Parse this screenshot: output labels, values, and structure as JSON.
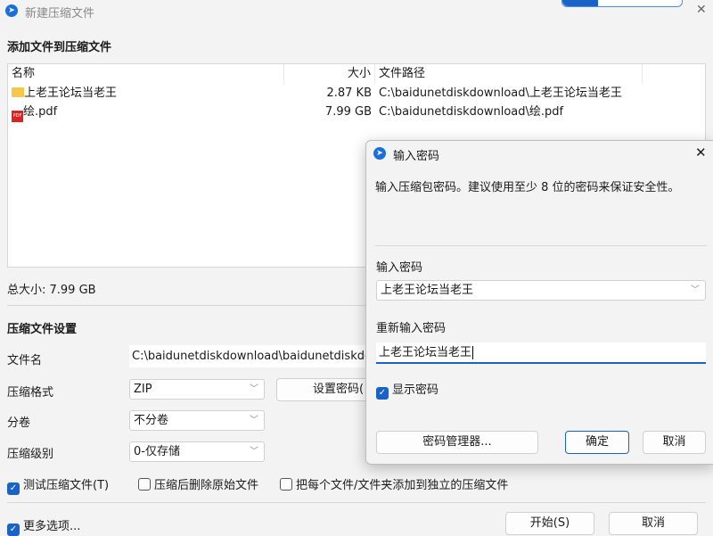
{
  "window": {
    "title": "新建压缩文件",
    "close": "✕"
  },
  "section_add": "添加文件到压缩文件",
  "file_list": {
    "columns": [
      "名称",
      "大小",
      "文件路径"
    ],
    "rows": [
      {
        "name": "上老王论坛当老王",
        "size": "2.87 KB",
        "path": "C:\\baidunetdiskdownload\\上老王论坛当老王",
        "icon": "folder-icon"
      },
      {
        "name": "绘.pdf",
        "size": "7.99 GB",
        "path": "C:\\baidunetdiskdownload\\绘.pdf",
        "icon": "pdf-icon"
      }
    ]
  },
  "total_size": "总大小: 7.99 GB",
  "section_settings": "压缩文件设置",
  "settings": {
    "filename_label": "文件名",
    "filename_value": "C:\\baidunetdiskdownload\\baidunetdiskdo",
    "format_label": "压缩格式",
    "format_value": "ZIP",
    "split_label": "分卷",
    "split_value": "不分卷",
    "level_label": "压缩级别",
    "level_value": "0-仅存储",
    "set_password": "设置密码("
  },
  "options": {
    "test": "测试压缩文件(T)",
    "delete": "压缩后删除原始文件",
    "separate": "把每个文件/文件夹添加到独立的压缩文件",
    "more": "更多选项..."
  },
  "buttons": {
    "start": "开始(S)",
    "cancel": "取消"
  },
  "dialog": {
    "title": "输入密码",
    "close": "✕",
    "hint": "输入压缩包密码。建议使用至少 8 位的密码来保证安全性。",
    "password_label": "输入密码",
    "password_value": "上老王论坛当老王",
    "confirm_label": "重新输入密码",
    "confirm_value": "上老王论坛当老王",
    "show_password": "显示密码",
    "manager": "密码管理器...",
    "ok": "确定",
    "cancel": "取消"
  }
}
